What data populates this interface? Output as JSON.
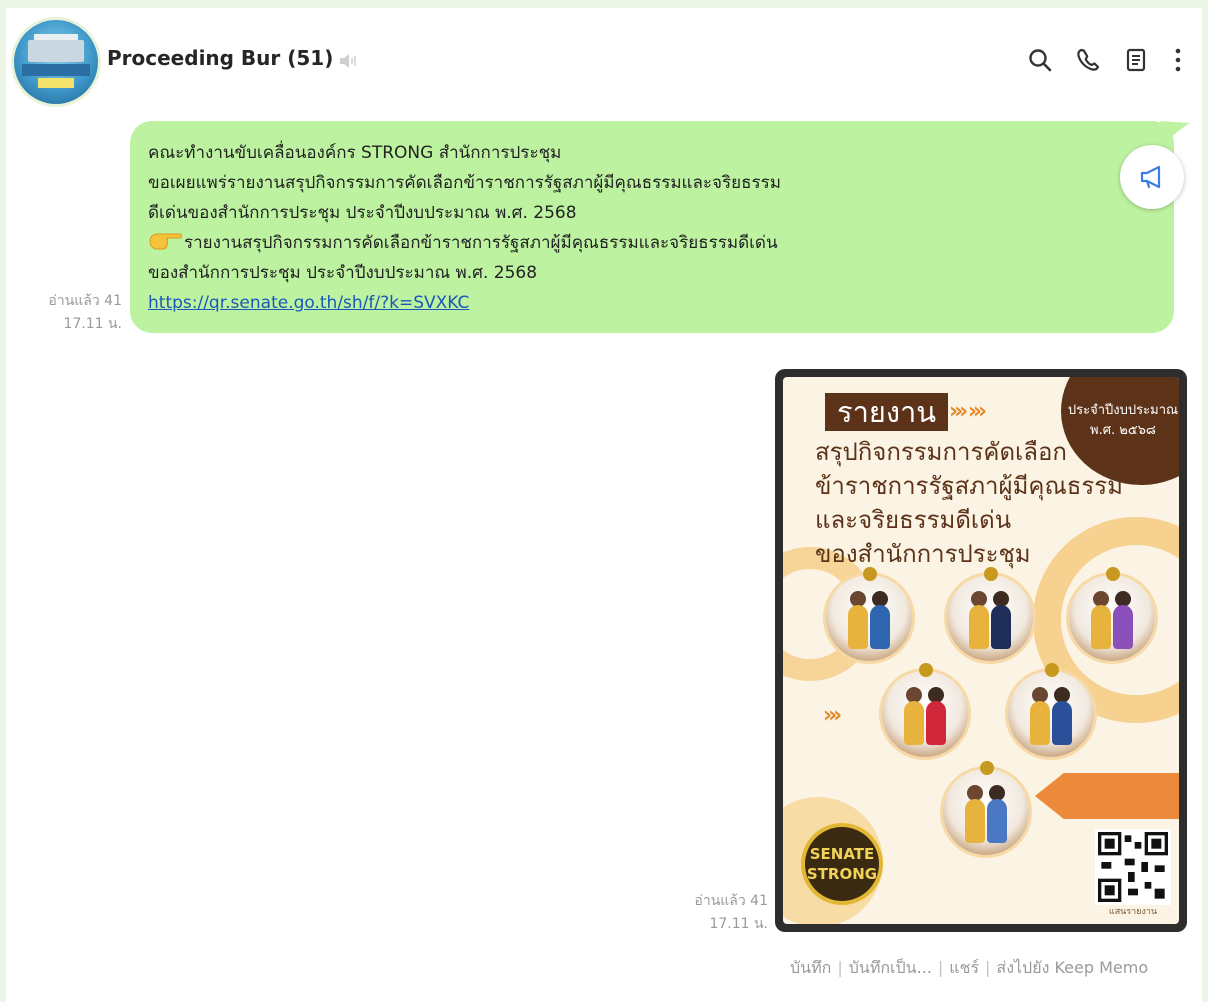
{
  "header": {
    "group_name": "Proceeding Bur (51)",
    "icons": [
      "search-icon",
      "phone-icon",
      "notes-icon",
      "more-vertical-icon"
    ]
  },
  "message": {
    "lines": [
      "คณะทำงานขับเคลื่อนองค์กร STRONG สำนักการประชุม",
      "ขอเผยแพร่รายงานสรุปกิจกรรมการคัดเลือกข้าราชการรัฐสภาผู้มีคุณธรรมและจริยธรรม",
      "ดีเด่นของสำนักการประชุม ประจำปีงบประมาณ พ.ศ. 2568",
      "รายงานสรุปกิจกรรมการคัดเลือกข้าราชการรัฐสภาผู้มีคุณธรรมและจริยธรรมดีเด่น",
      "ของสำนักการประชุม ประจำปีงบประมาณ พ.ศ. 2568"
    ],
    "link": "https://qr.senate.go.th/sh/f/?k=SVXKC",
    "read_status": "อ่านแล้ว 41",
    "time": "17.11 น."
  },
  "image_message": {
    "read_status": "อ่านแล้ว 41",
    "time": "17.11 น.",
    "poster": {
      "title_box": "รายงาน",
      "arrows": "›››  ›››",
      "corner_text": [
        "ประจำปีงบประมาณ",
        "พ.ศ. ๒๕๖๘"
      ],
      "headline_lines": [
        "สรุปกิจกรรมการคัดเลือก",
        "ข้าราชการรัฐสภาผู้มีคุณธรรม",
        "และจริยธรรมดีเด่น",
        "ของสำนักการประชุม"
      ],
      "badge_lines": [
        "SENATE",
        "STRONG"
      ],
      "qr_caption": "แสนรายงาน"
    }
  },
  "image_actions": {
    "save": "บันทึก",
    "save_as": "บันทึกเป็น...",
    "share": "แชร์",
    "send_keep": "ส่งไปยัง Keep Memo",
    "separator": "|"
  }
}
